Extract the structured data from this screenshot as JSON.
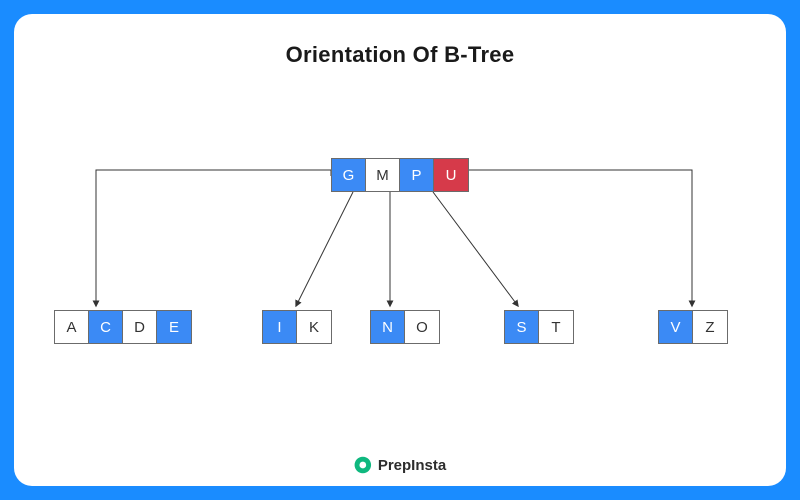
{
  "title": "Orientation Of B-Tree",
  "colors": {
    "blue": "#3b8af5",
    "red": "#d63a4a",
    "border": "#6b6b6b"
  },
  "root": {
    "keys": [
      {
        "label": "G",
        "tone": "blue"
      },
      {
        "label": "M",
        "tone": "plain"
      },
      {
        "label": "P",
        "tone": "blue"
      },
      {
        "label": "U",
        "tone": "red"
      }
    ]
  },
  "children": [
    {
      "keys": [
        {
          "label": "A",
          "tone": "plain"
        },
        {
          "label": "C",
          "tone": "blue"
        },
        {
          "label": "D",
          "tone": "plain"
        },
        {
          "label": "E",
          "tone": "blue"
        }
      ]
    },
    {
      "keys": [
        {
          "label": "I",
          "tone": "blue"
        },
        {
          "label": "K",
          "tone": "plain"
        }
      ]
    },
    {
      "keys": [
        {
          "label": "N",
          "tone": "blue"
        },
        {
          "label": "O",
          "tone": "plain"
        }
      ]
    },
    {
      "keys": [
        {
          "label": "S",
          "tone": "blue"
        },
        {
          "label": "T",
          "tone": "plain"
        }
      ]
    },
    {
      "keys": [
        {
          "label": "V",
          "tone": "blue"
        },
        {
          "label": "Z",
          "tone": "plain"
        }
      ]
    }
  ],
  "brand": {
    "name": "PrepInsta"
  }
}
